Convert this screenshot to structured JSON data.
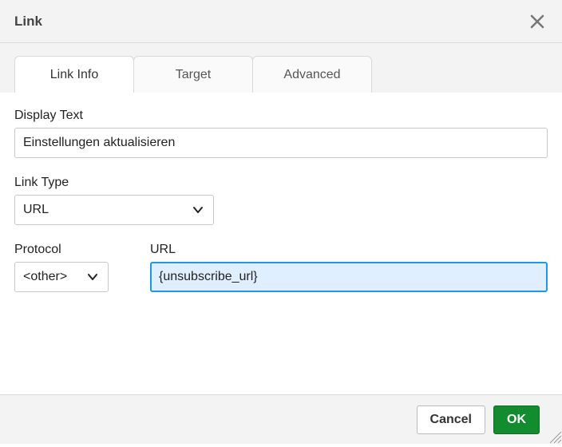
{
  "dialog": {
    "title": "Link"
  },
  "tabs": {
    "items": [
      {
        "label": "Link Info"
      },
      {
        "label": "Target"
      },
      {
        "label": "Advanced"
      }
    ]
  },
  "fields": {
    "displayText": {
      "label": "Display Text",
      "value": "Einstellungen aktualisieren"
    },
    "linkType": {
      "label": "Link Type",
      "value": "URL"
    },
    "protocol": {
      "label": "Protocol",
      "value": "<other>"
    },
    "url": {
      "label": "URL",
      "value": "{unsubscribe_url}"
    }
  },
  "buttons": {
    "cancel": "Cancel",
    "ok": "OK"
  }
}
